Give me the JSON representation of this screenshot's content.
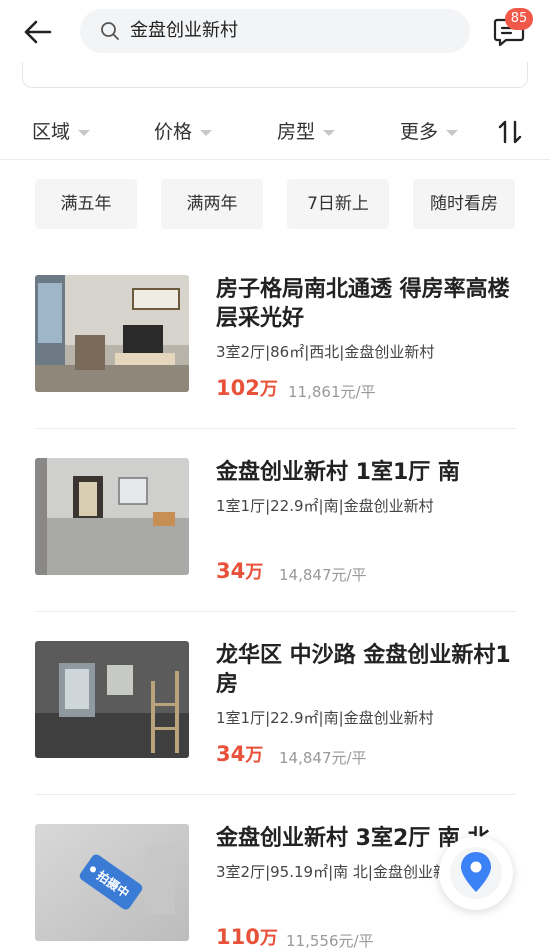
{
  "header": {
    "search_value": "金盘创业新村",
    "message_badge": "85"
  },
  "filters": {
    "items": [
      {
        "label": "区域"
      },
      {
        "label": "价格"
      },
      {
        "label": "房型"
      },
      {
        "label": "更多"
      }
    ],
    "sort_icon": "sort-updown-icon"
  },
  "tags": [
    {
      "label": "满五年"
    },
    {
      "label": "满两年"
    },
    {
      "label": "7日新上"
    },
    {
      "label": "随时看房"
    }
  ],
  "listings": [
    {
      "title": "房子格局南北通透 得房率高楼层采光好",
      "meta": "3室2厅|86㎡|西北|金盘创业新村",
      "price": "102",
      "price_unit": "万",
      "unit_price": "11,861元/平"
    },
    {
      "title": "金盘创业新村 1室1厅 南",
      "meta": "1室1厅|22.9㎡|南|金盘创业新村",
      "price": "34",
      "price_unit": "万",
      "unit_price": "14,847元/平"
    },
    {
      "title": "龙华区 中沙路 金盘创业新村1房",
      "meta": "1室1厅|22.9㎡|南|金盘创业新村",
      "price": "34",
      "price_unit": "万",
      "unit_price": "14,847元/平"
    },
    {
      "title": "金盘创业新村 3室2厅 南 北",
      "meta": "3室2厅|95.19㎡|南 北|金盘创业新村",
      "price": "110",
      "price_unit": "万",
      "unit_price": "11,556元/平",
      "thumb_tag": "拍摄中"
    }
  ],
  "colors": {
    "accent_price": "#e8523a",
    "badge": "#f0594a",
    "map_pin": "#3b82f6"
  }
}
